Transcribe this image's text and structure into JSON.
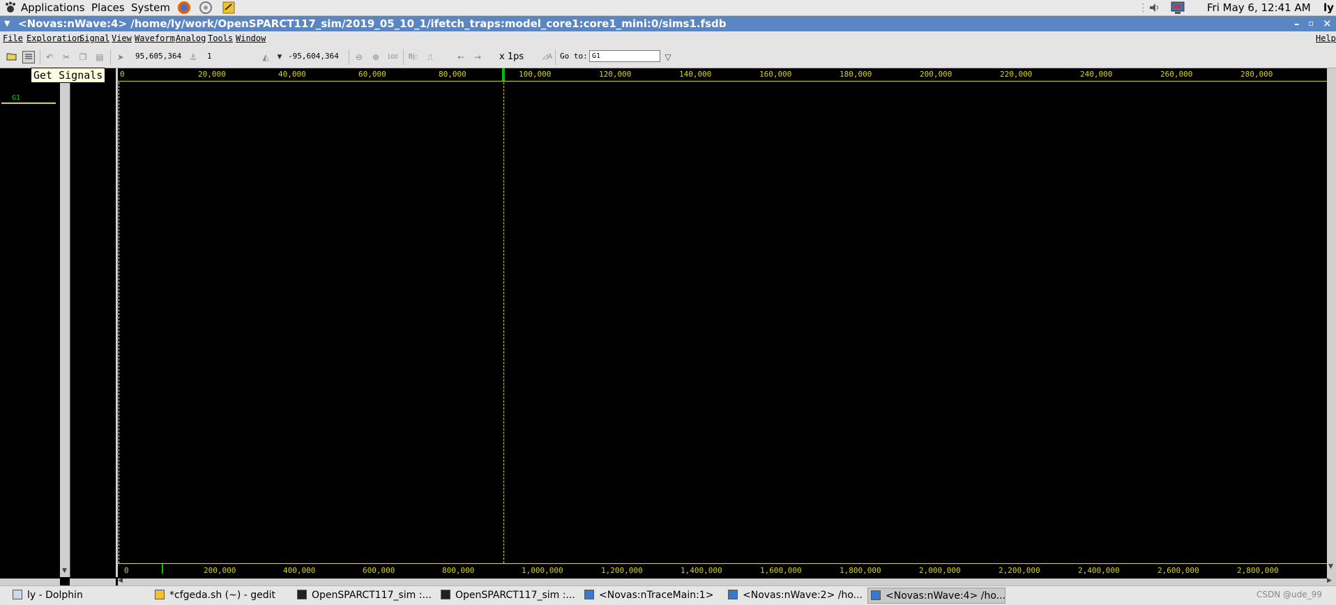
{
  "top_panel": {
    "applications": "Applications",
    "places": "Places",
    "system": "System",
    "clock": "Fri May  6, 12:41 AM",
    "user": "ly"
  },
  "window": {
    "title": "<Novas:nWave:4> /home/ly/work/OpenSPARCT117_sim/2019_05_10_1/ifetch_traps:model_core1:core1_mini:0/sims1.fsdb"
  },
  "menu": {
    "file": "File",
    "exploration": "Exploration",
    "signal": "Signal",
    "view": "View",
    "waveform": "Waveform",
    "analog": "Analog",
    "tools": "Tools",
    "window": "Window",
    "help": "Help"
  },
  "toolbar": {
    "cursor_time": "95,605,364",
    "marker_value": "1",
    "delta_time": "-95,604,364",
    "time_unit": "x 1ps",
    "goto_label": "Go to:",
    "goto_value": "G1"
  },
  "tooltip": {
    "text": "Get Signals"
  },
  "signal_pane": {
    "group_label": "G1"
  },
  "ruler_top": {
    "ticks": [
      "0",
      "20,000",
      "40,000",
      "60,000",
      "80,000",
      "100,000",
      "120,000",
      "140,000",
      "160,000",
      "180,000",
      "200,000",
      "220,000",
      "240,000",
      "260,000",
      "280,000"
    ]
  },
  "ruler_bottom": {
    "ticks": [
      "0",
      "200,000",
      "400,000",
      "600,000",
      "800,000",
      "1,000,000",
      "1,200,000",
      "1,400,000",
      "1,600,000",
      "1,800,000",
      "2,000,000",
      "2,200,000",
      "2,400,000",
      "2,600,000",
      "2,800,000"
    ]
  },
  "taskbar": {
    "items": [
      {
        "label": "ly - Dolphin"
      },
      {
        "label": "*cfgeda.sh (~) - gedit"
      },
      {
        "label": "OpenSPARCT117_sim :..."
      },
      {
        "label": "OpenSPARCT117_sim :..."
      },
      {
        "label": "<Novas:nTraceMain:1>"
      },
      {
        "label": "<Novas:nWave:2> /ho..."
      },
      {
        "label": "<Novas:nWave:4> /ho..."
      }
    ],
    "watermark": "CSDN @ude_99"
  },
  "colors": {
    "ruler": "#d8d800",
    "cursor": "#d8d800",
    "title_bar": "#5a86c4",
    "group_label": "#00d000"
  }
}
